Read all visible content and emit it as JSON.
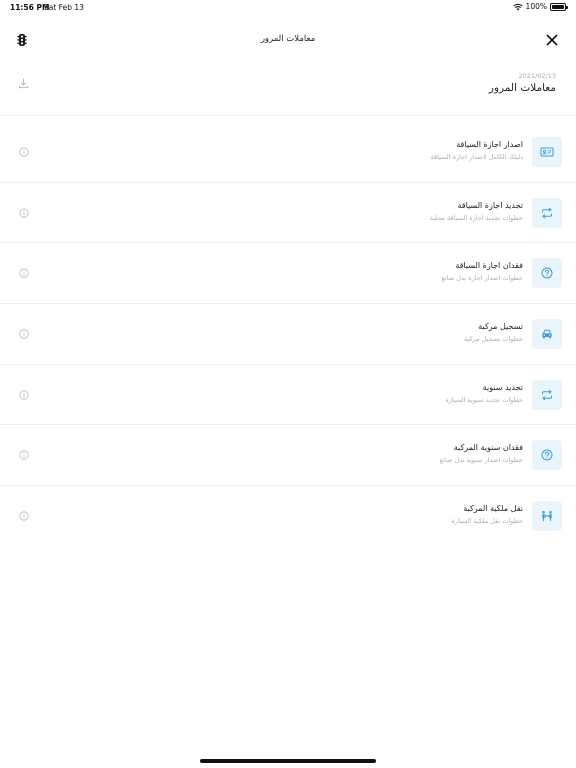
{
  "status_bar": {
    "time": "11:56 PM",
    "date": "Sat Feb 13",
    "battery": "100%",
    "battery_level": 1.0
  },
  "nav": {
    "title": "معاملات المرور",
    "left_icon": "traffic-light-icon",
    "right_icon": "close-icon"
  },
  "header": {
    "date": "2021/02/13",
    "title": "معاملات المرور",
    "action_icon": "download-icon"
  },
  "colors": {
    "accent": "#3a9fd6",
    "tile_bg": "#e9f4fb",
    "muted": "#b0b0b0",
    "divider": "#eeeeee"
  },
  "items": [
    {
      "title": "اصدار اجازة السياقة",
      "subtitle": "دليلك الكامل لاصدار اجازة السياقة",
      "icon": "id-card-icon"
    },
    {
      "title": "تجديد اجازة السياقة",
      "subtitle": "خطوات تجديد اجازة السياقة محلية",
      "icon": "repeat-icon"
    },
    {
      "title": "فقدان اجازة السياقة",
      "subtitle": "خطوات اصدار اجازة بدل ضائع",
      "icon": "question-icon"
    },
    {
      "title": "تسجيل مركبة",
      "subtitle": "خطوات تسجيل مركبة",
      "icon": "car-icon"
    },
    {
      "title": "تجديد سنوية",
      "subtitle": "خطوات تجديد سنوية السيارة",
      "icon": "repeat-icon"
    },
    {
      "title": "فقدان سنوية المركبة",
      "subtitle": "خطوات اصدار سنوية بدل ضائع",
      "icon": "question-icon"
    },
    {
      "title": "نقل ملكية المركبة",
      "subtitle": "خطوات نقل ملكية السيارة",
      "icon": "people-transfer-icon"
    }
  ]
}
